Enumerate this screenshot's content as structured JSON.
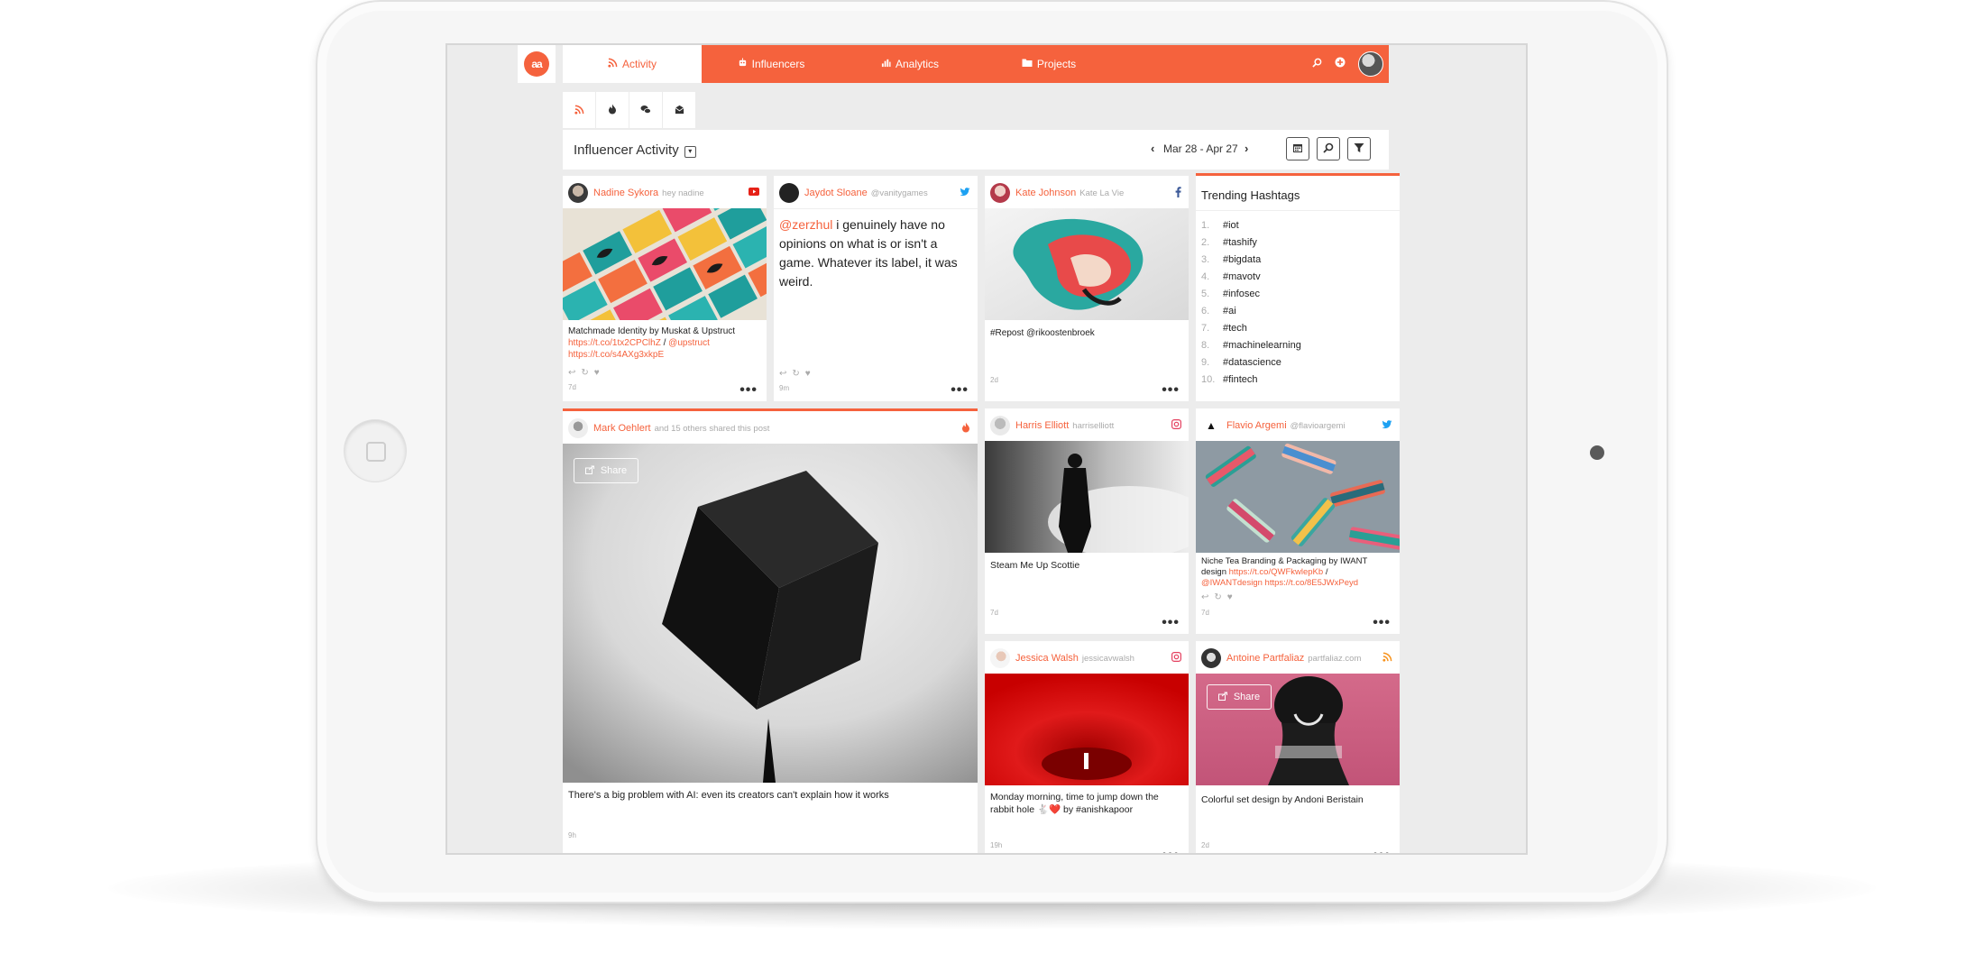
{
  "nav": {
    "logo": "aa",
    "tabs": [
      {
        "label": "Activity",
        "icon": "rss-icon",
        "active": true
      },
      {
        "label": "Influencers",
        "icon": "robot-icon",
        "active": false
      },
      {
        "label": "Analytics",
        "icon": "bar-chart-icon",
        "active": false
      },
      {
        "label": "Projects",
        "icon": "folder-icon",
        "active": false
      }
    ],
    "right_icons": [
      "search-icon",
      "plus-circle-icon",
      "user-avatar"
    ]
  },
  "subtabs": [
    {
      "icon": "rss-icon",
      "active": true
    },
    {
      "icon": "fire-icon",
      "active": false
    },
    {
      "icon": "chat-icon",
      "active": false
    },
    {
      "icon": "mail-icon",
      "active": false
    }
  ],
  "header": {
    "title": "Influencer Activity",
    "date_range": "Mar 28 - Apr 27",
    "tools": [
      "calendar-icon",
      "search-icon",
      "filter-icon"
    ]
  },
  "colors": {
    "accent": "#f5623d",
    "youtube": "#e62117",
    "twitter": "#1da1f2",
    "facebook": "#3b5998",
    "instagram": "#e4405f",
    "rss": "#f7931e"
  },
  "posts": {
    "nadine": {
      "name": "Nadine Sykora",
      "handle": "hey nadine",
      "network": "youtube-icon",
      "caption": "Matchmade Identity by Muskat & Upstruct",
      "link1": "https://t.co/1tx2CPClhZ",
      "sep": " / ",
      "mention": "@upstruct",
      "link2": "https://t.co/s4AXg3xkpE",
      "age": "7d"
    },
    "jaydot": {
      "name": "Jaydot Sloane",
      "handle": "@vanitygames",
      "network": "twitter-icon",
      "mention": "@zerzhul",
      "text": " i genuinely have no opinions on what is or isn't a game. Whatever its label, it was weird.",
      "age": "9m"
    },
    "kate": {
      "name": "Kate Johnson",
      "handle": "Kate La Vie",
      "network": "facebook-icon",
      "caption": "#Repost @rikoostenbroek",
      "age": "2d"
    },
    "mark": {
      "name": "Mark Oehlert",
      "handle": "and 15 others shared this post",
      "network": "fire-icon",
      "share": "Share",
      "caption": "There's a big problem with AI: even its creators can't explain how it works",
      "age": "9h"
    },
    "harris": {
      "name": "Harris Elliott",
      "handle": "harriselliott",
      "network": "instagram-icon",
      "caption": "Steam Me Up Scottie",
      "age": "7d"
    },
    "flavio": {
      "name": "Flavio Argemi",
      "handle": "@flavioargemi",
      "network": "twitter-icon",
      "caption": "Niche Tea Branding & Packaging by IWANT design",
      "link1": "https://t.co/QWFkwlepKb",
      "sep": " / ",
      "mention": "@IWANTdesign",
      "link2": "https://t.co/8E5JWxPeyd",
      "age": "7d"
    },
    "jessica": {
      "name": "Jessica Walsh",
      "handle": "jessicavwalsh",
      "network": "instagram-icon",
      "caption": "Monday morning, time to jump down the rabbit hole 🐇❤️ by #anishkapoor",
      "age": "19h"
    },
    "antoine": {
      "name": "Antoine Partfaliaz",
      "handle": "partfaliaz.com",
      "network": "rss-icon",
      "share": "Share",
      "caption": "Colorful set design by Andoni Beristain",
      "age": "2d"
    }
  },
  "trending": {
    "title": "Trending Hashtags",
    "items": [
      {
        "n": "1.",
        "tag": "#iot"
      },
      {
        "n": "2.",
        "tag": "#tashify"
      },
      {
        "n": "3.",
        "tag": "#bigdata"
      },
      {
        "n": "4.",
        "tag": "#mavotv"
      },
      {
        "n": "5.",
        "tag": "#infosec"
      },
      {
        "n": "6.",
        "tag": "#ai"
      },
      {
        "n": "7.",
        "tag": "#tech"
      },
      {
        "n": "8.",
        "tag": "#machinelearning"
      },
      {
        "n": "9.",
        "tag": "#datascience"
      },
      {
        "n": "10.",
        "tag": "#fintech"
      }
    ]
  }
}
